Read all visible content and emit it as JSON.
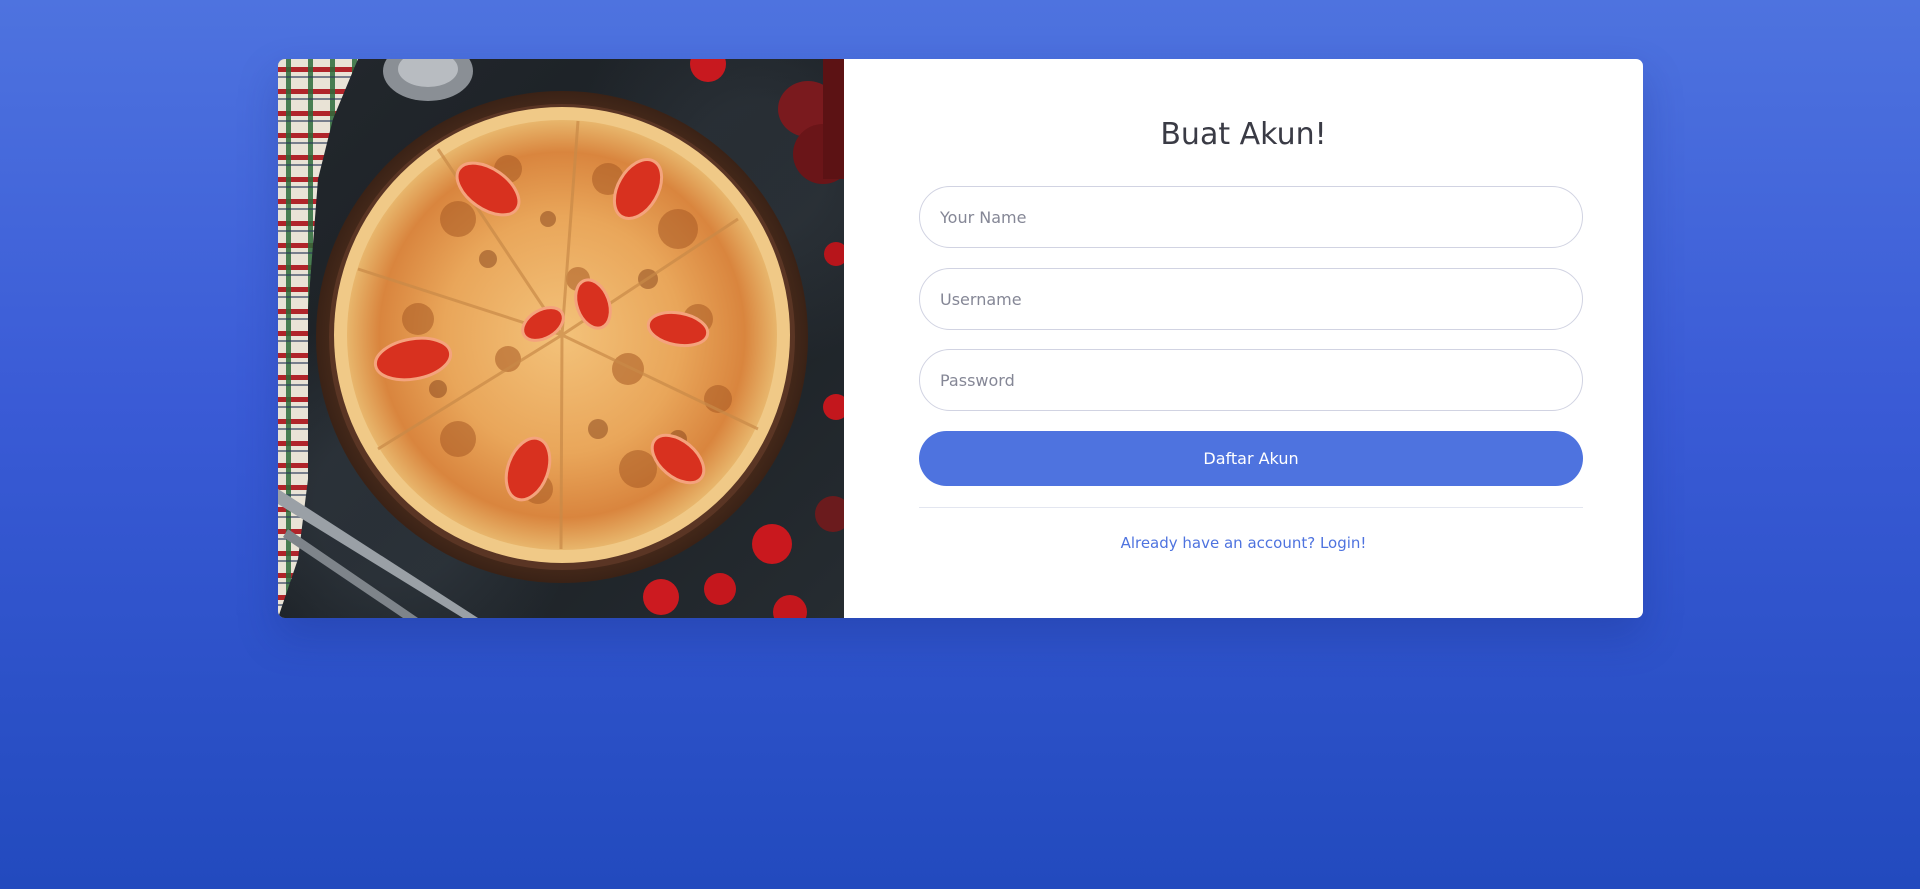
{
  "form": {
    "title": "Buat Akun!",
    "name_placeholder": "Your Name",
    "username_placeholder": "Username",
    "password_placeholder": "Password",
    "submit_label": "Daftar Akun",
    "login_link": "Already have an account? Login!"
  },
  "colors": {
    "background_top": "#4e73df",
    "background_bottom": "#224abe",
    "primary": "#4e73df",
    "card": "#ffffff"
  },
  "image": {
    "icon": "pizza-photo"
  }
}
